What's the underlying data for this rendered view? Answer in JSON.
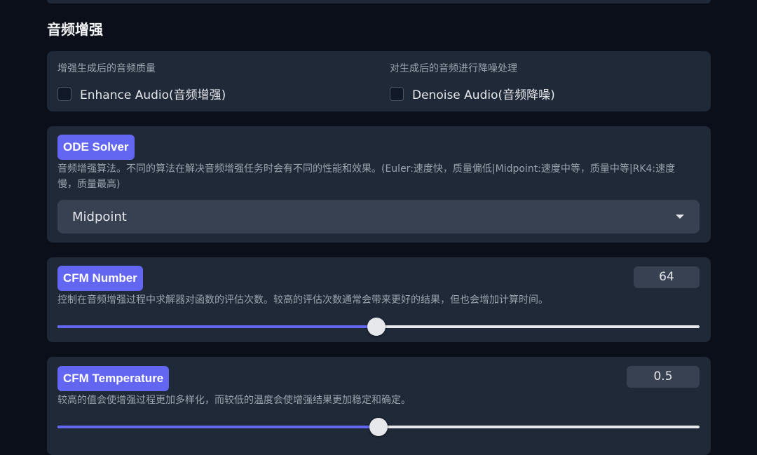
{
  "section": {
    "title": "音频增强"
  },
  "enhance": {
    "description": "增强生成后的音频质量",
    "label": "Enhance Audio(音频增强)",
    "checked": false
  },
  "denoise": {
    "description": "对生成后的音频进行降噪处理",
    "label": "Denoise Audio(音频降噪)",
    "checked": false
  },
  "ode_solver": {
    "label": "ODE Solver",
    "info": "音频增强算法。不同的算法在解决音频增强任务时会有不同的性能和效果。(Euler:速度快，质量偏低|Midpoint:速度中等，质量中等|RK4:速度慢，质量最高)",
    "selected": "Midpoint"
  },
  "cfm_number": {
    "label": "CFM Number",
    "info": "控制在音频增强过程中求解器对函数的评估次数。较高的评估次数通常会带来更好的结果，但也会增加计算时间。",
    "value": "64",
    "slider_fraction": 0.497
  },
  "cfm_temperature": {
    "label": "CFM Temperature",
    "info": "较高的值会使增强过程更加多样化，而较低的温度会使增强结果更加稳定和确定。",
    "value": "0.5",
    "slider_fraction": 0.5
  },
  "colors": {
    "accent": "#6366f1",
    "panel": "#1f2937",
    "background": "#0b0f19"
  }
}
